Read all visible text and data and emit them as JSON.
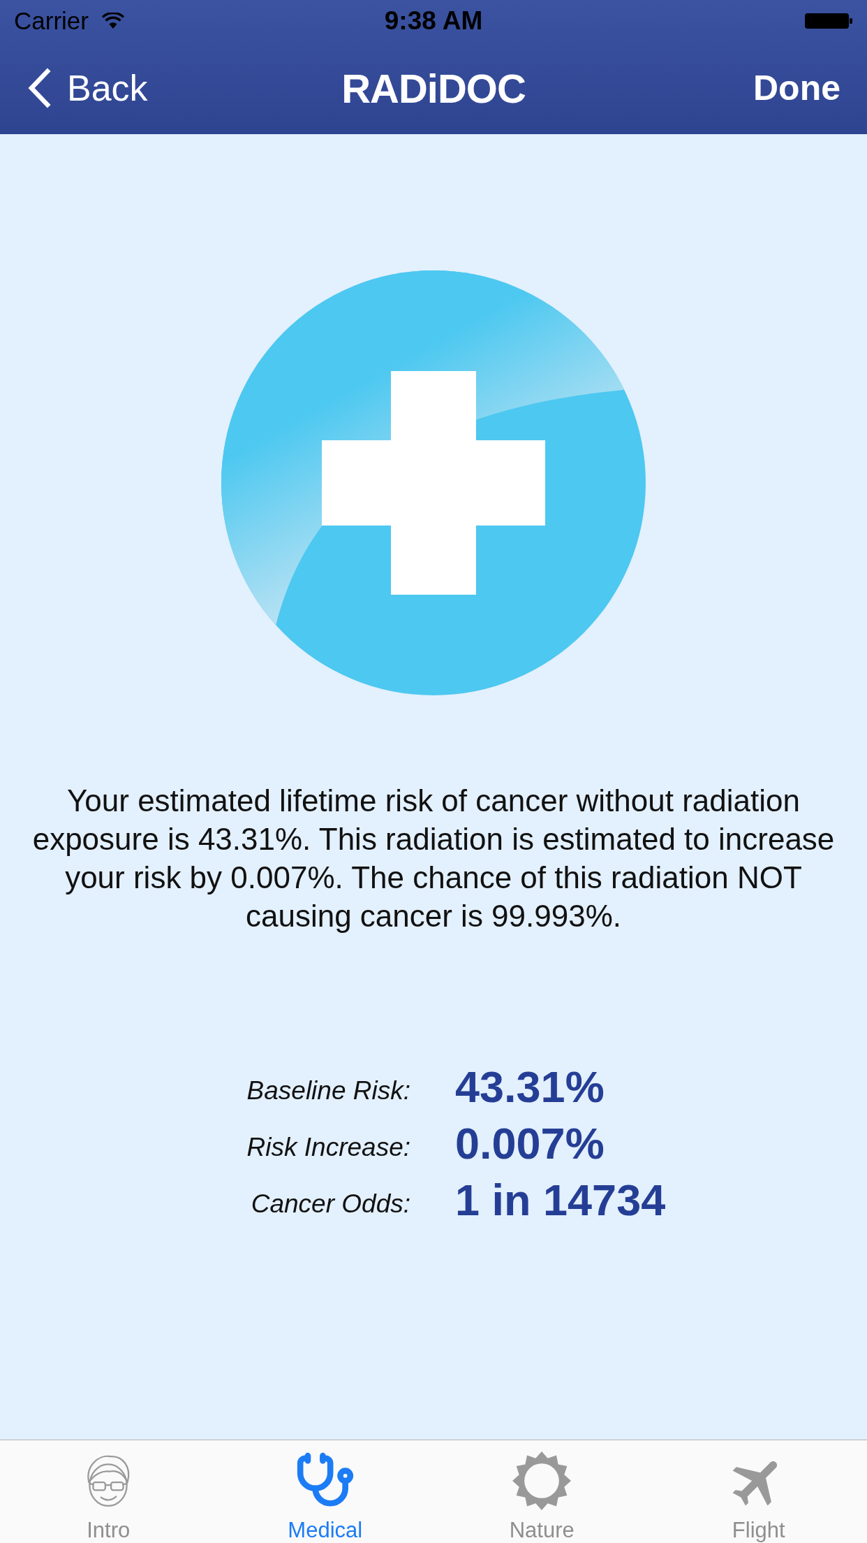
{
  "status_bar": {
    "carrier": "Carrier",
    "time": "9:38 AM"
  },
  "nav_bar": {
    "back": "Back",
    "title": "RADiDOC",
    "done": "Done"
  },
  "summary": "Your estimated lifetime risk of cancer without radiation exposure is 43.31%. This radiation is estimated to increase your risk by 0.007%. The chance of this radiation NOT causing cancer is 99.993%.",
  "stats": [
    {
      "label": "Baseline Risk:",
      "value": "43.31%"
    },
    {
      "label": "Risk Increase:",
      "value": "0.007%"
    },
    {
      "label": "Cancer Odds:",
      "value": "1 in 14734"
    }
  ],
  "tabs": [
    {
      "label": "Intro",
      "kind": "face",
      "selected": false
    },
    {
      "label": "Medical",
      "kind": "stethoscope",
      "selected": true
    },
    {
      "label": "Nature",
      "kind": "sun",
      "selected": false
    },
    {
      "label": "Flight",
      "kind": "plane",
      "selected": false
    }
  ]
}
